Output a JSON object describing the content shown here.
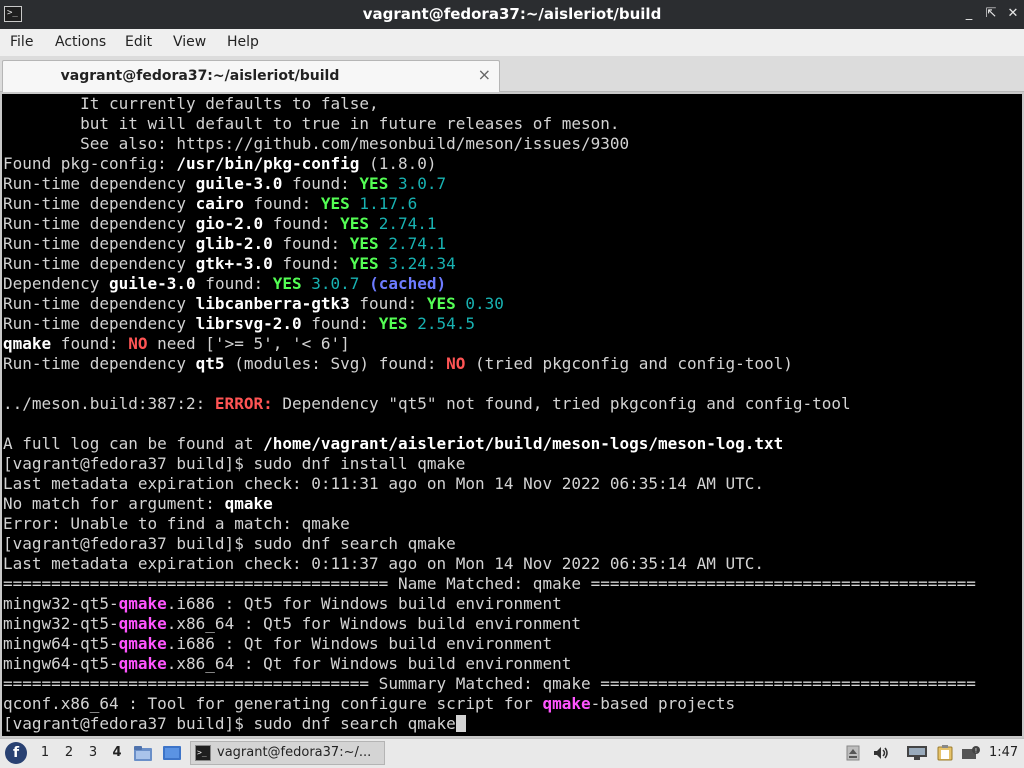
{
  "window": {
    "title": "vagrant@fedora37:~/aisleriot/build",
    "minimize_label": "_",
    "maximize_label": "⇱",
    "close_label": "✕"
  },
  "menu": {
    "file": "File",
    "actions": "Actions",
    "edit": "Edit",
    "view": "View",
    "help": "Help"
  },
  "tab": {
    "label": "vagrant@fedora37:~/aisleriot/build",
    "close": "×"
  },
  "terminal": {
    "lines": [
      [
        {
          "t": "        It currently defaults to false,"
        }
      ],
      [
        {
          "t": "        but it will default to true in future releases of meson."
        }
      ],
      [
        {
          "t": "        See also: https://github.com/mesonbuild/meson/issues/9300"
        }
      ],
      [
        {
          "t": "Found pkg-config: "
        },
        {
          "t": "/usr/bin/pkg-config",
          "s": "b"
        },
        {
          "t": " (1.8.0)"
        }
      ],
      [
        {
          "t": "Run-time dependency "
        },
        {
          "t": "guile-3.0",
          "s": "b"
        },
        {
          "t": " found: "
        },
        {
          "t": "YES",
          "s": "g"
        },
        {
          "t": " 3.0.7",
          "s": "c"
        }
      ],
      [
        {
          "t": "Run-time dependency "
        },
        {
          "t": "cairo",
          "s": "b"
        },
        {
          "t": " found: "
        },
        {
          "t": "YES",
          "s": "g"
        },
        {
          "t": " 1.17.6",
          "s": "c"
        }
      ],
      [
        {
          "t": "Run-time dependency "
        },
        {
          "t": "gio-2.0",
          "s": "b"
        },
        {
          "t": " found: "
        },
        {
          "t": "YES",
          "s": "g"
        },
        {
          "t": " 2.74.1",
          "s": "c"
        }
      ],
      [
        {
          "t": "Run-time dependency "
        },
        {
          "t": "glib-2.0",
          "s": "b"
        },
        {
          "t": " found: "
        },
        {
          "t": "YES",
          "s": "g"
        },
        {
          "t": " 2.74.1",
          "s": "c"
        }
      ],
      [
        {
          "t": "Run-time dependency "
        },
        {
          "t": "gtk+-3.0",
          "s": "b"
        },
        {
          "t": " found: "
        },
        {
          "t": "YES",
          "s": "g"
        },
        {
          "t": " 3.24.34",
          "s": "c"
        }
      ],
      [
        {
          "t": "Dependency "
        },
        {
          "t": "guile-3.0",
          "s": "b"
        },
        {
          "t": " found: "
        },
        {
          "t": "YES",
          "s": "g"
        },
        {
          "t": " 3.0.7 ",
          "s": "c"
        },
        {
          "t": "(cached)",
          "s": "bl"
        }
      ],
      [
        {
          "t": "Run-time dependency "
        },
        {
          "t": "libcanberra-gtk3",
          "s": "b"
        },
        {
          "t": " found: "
        },
        {
          "t": "YES",
          "s": "g"
        },
        {
          "t": " 0.30",
          "s": "c"
        }
      ],
      [
        {
          "t": "Run-time dependency "
        },
        {
          "t": "librsvg-2.0",
          "s": "b"
        },
        {
          "t": " found: "
        },
        {
          "t": "YES",
          "s": "g"
        },
        {
          "t": " 2.54.5",
          "s": "c"
        }
      ],
      [
        {
          "t": "qmake",
          "s": "b"
        },
        {
          "t": " found: "
        },
        {
          "t": "NO",
          "s": "r"
        },
        {
          "t": " need ['>= 5', '< 6']"
        }
      ],
      [
        {
          "t": "Run-time dependency "
        },
        {
          "t": "qt5",
          "s": "b"
        },
        {
          "t": " (modules: Svg) found: "
        },
        {
          "t": "NO",
          "s": "r"
        },
        {
          "t": " (tried pkgconfig and config-tool)"
        }
      ],
      [],
      [
        {
          "t": "../meson.build:387:2: "
        },
        {
          "t": "ERROR:",
          "s": "r"
        },
        {
          "t": " Dependency \"qt5\" not found, tried pkgconfig and config-tool"
        }
      ],
      [],
      [
        {
          "t": "A full log can be found at "
        },
        {
          "t": "/home/vagrant/aisleriot/build/meson-logs/meson-log.txt",
          "s": "b"
        }
      ],
      [
        {
          "t": "[vagrant@fedora37 build]$ sudo dnf install qmake"
        }
      ],
      [
        {
          "t": "Last metadata expiration check: 0:11:31 ago on Mon 14 Nov 2022 06:35:14 AM UTC."
        }
      ],
      [
        {
          "t": "No match for argument: "
        },
        {
          "t": "qmake",
          "s": "b"
        }
      ],
      [
        {
          "t": "Error: Unable to find a match: qmake"
        }
      ],
      [
        {
          "t": "[vagrant@fedora37 build]$ sudo dnf search qmake"
        }
      ],
      [
        {
          "t": "Last metadata expiration check: 0:11:37 ago on Mon 14 Nov 2022 06:35:14 AM UTC."
        }
      ],
      [
        {
          "t": "======================================== Name Matched: qmake ========================================"
        }
      ],
      [
        {
          "t": "mingw32-qt5-"
        },
        {
          "t": "qmake",
          "s": "m"
        },
        {
          "t": ".i686 : Qt5 for Windows build environment"
        }
      ],
      [
        {
          "t": "mingw32-qt5-"
        },
        {
          "t": "qmake",
          "s": "m"
        },
        {
          "t": ".x86_64 : Qt5 for Windows build environment"
        }
      ],
      [
        {
          "t": "mingw64-qt5-"
        },
        {
          "t": "qmake",
          "s": "m"
        },
        {
          "t": ".i686 : Qt for Windows build environment"
        }
      ],
      [
        {
          "t": "mingw64-qt5-"
        },
        {
          "t": "qmake",
          "s": "m"
        },
        {
          "t": ".x86_64 : Qt for Windows build environment"
        }
      ],
      [
        {
          "t": "====================================== Summary Matched: qmake ======================================="
        }
      ],
      [
        {
          "t": "qconf.x86_64 : Tool for generating configure script for "
        },
        {
          "t": "qmake",
          "s": "m"
        },
        {
          "t": "-based projects"
        }
      ],
      [
        {
          "t": "[vagrant@fedora37 build]$ sudo dnf search qmake"
        },
        {
          "cursor": true
        }
      ]
    ]
  },
  "taskbar": {
    "start_icon": "fedora-start-icon",
    "start_glyph": "f",
    "workspaces": [
      "1",
      "2",
      "3",
      "4"
    ],
    "active_workspace": "4",
    "task_label": "vagrant@fedora37:~/...",
    "task_glyph": ">_",
    "clock": "1:47"
  },
  "colors": {
    "bold": "#ffffff",
    "yes": "#54ff54",
    "error": "#ff5454",
    "cached": "#6d7bff",
    "match": "#ff54ff",
    "version": "#18b2b2",
    "terminal_bg": "#000000"
  }
}
